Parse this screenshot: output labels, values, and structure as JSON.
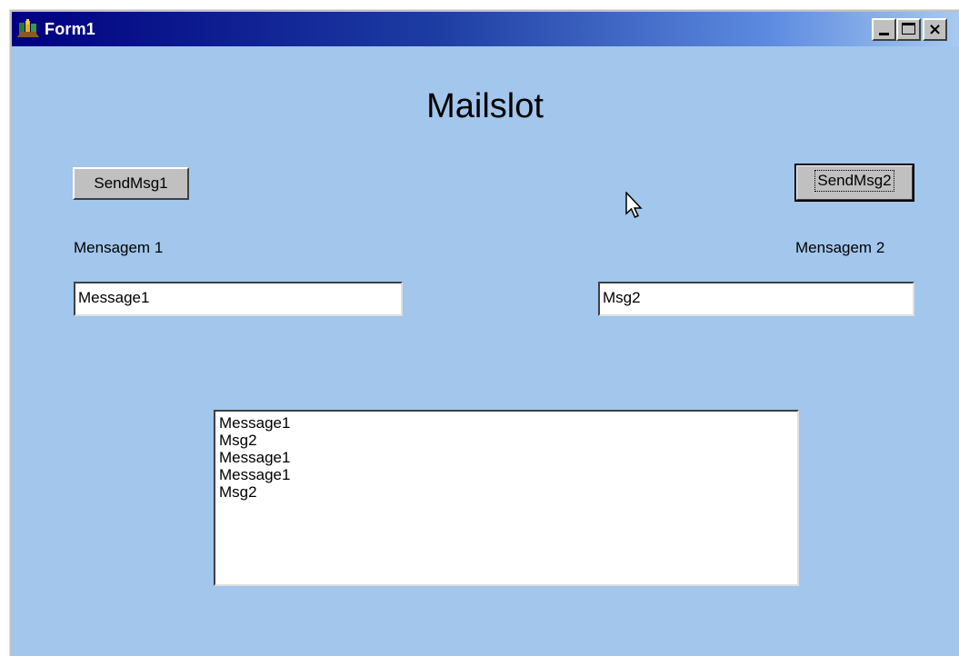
{
  "window": {
    "title": "Form1",
    "controls": {
      "minimize": "minimize",
      "maximize": "maximize",
      "close": "×"
    }
  },
  "form": {
    "heading": "Mailslot",
    "send_button_1": "SendMsg1",
    "send_button_2": "SendMsg2",
    "label_1": "Mensagem 1",
    "label_2": "Mensagem 2",
    "textbox_1_value": "Message1",
    "textbox_2_value": "Msg2",
    "list_items": [
      "Message1",
      "Msg2",
      "Message1",
      "Message1",
      "Msg2"
    ]
  },
  "colors": {
    "client_background": "#a2c6ec",
    "titlebar_start": "#000080",
    "titlebar_end": "#a6caf0",
    "button_face": "#c0c0c0"
  },
  "icons": {
    "app": "delphi-app-icon",
    "cursor": "mouse-pointer-icon"
  }
}
